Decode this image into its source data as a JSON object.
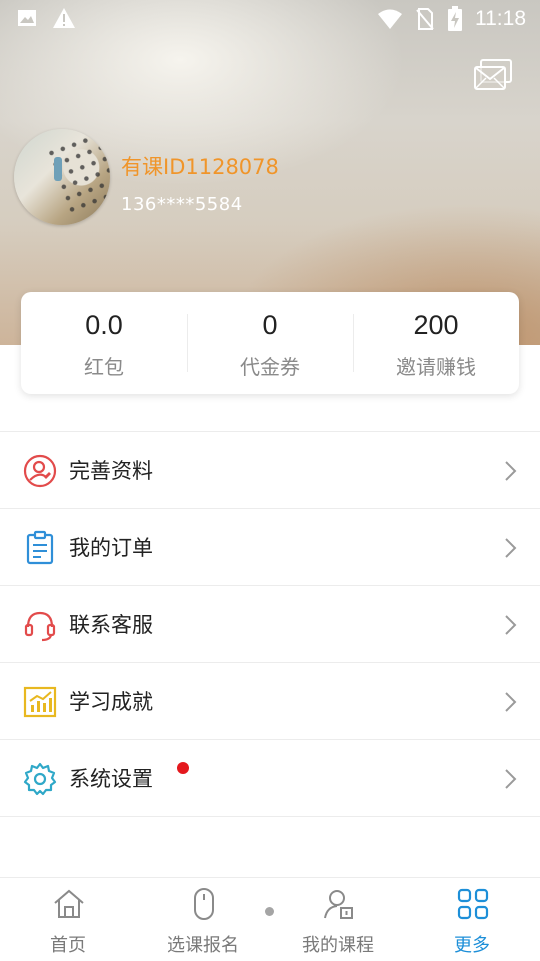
{
  "status_bar": {
    "time": "11:18",
    "left_icons": [
      "image-icon",
      "warning-icon"
    ],
    "right_icons": [
      "wifi-icon",
      "no-sim-icon",
      "battery-charging-icon"
    ]
  },
  "header": {
    "message_icon": "envelope-stack-icon"
  },
  "profile": {
    "user_id": "有课ID1128078",
    "phone": "136****5584"
  },
  "stats": [
    {
      "value": "0.0",
      "label": "红包"
    },
    {
      "value": "0",
      "label": "代金券"
    },
    {
      "value": "200",
      "label": "邀请赚钱"
    }
  ],
  "menu": [
    {
      "label": "完善资料",
      "icon": "profile-icon",
      "color": "#e24b4b"
    },
    {
      "label": "我的订单",
      "icon": "order-clipboard-icon",
      "color": "#2f8fd8"
    },
    {
      "label": "联系客服",
      "icon": "headset-icon",
      "color": "#e24b4b"
    },
    {
      "label": "学习成就",
      "icon": "achievement-chart-icon",
      "color": "#e8b820"
    },
    {
      "label": "系统设置",
      "icon": "gear-icon",
      "color": "#2fa8c8",
      "badge": true
    }
  ],
  "tabbar": [
    {
      "label": "首页",
      "icon": "home-icon",
      "active": false
    },
    {
      "label": "选课报名",
      "icon": "mouse-icon",
      "active": false
    },
    {
      "label": "我的课程",
      "icon": "my-course-icon",
      "active": false
    },
    {
      "label": "更多",
      "icon": "grid-icon",
      "active": true
    }
  ],
  "colors": {
    "accent": "#1d8fd8",
    "user_id": "#f0952a",
    "badge": "#e4181d"
  }
}
